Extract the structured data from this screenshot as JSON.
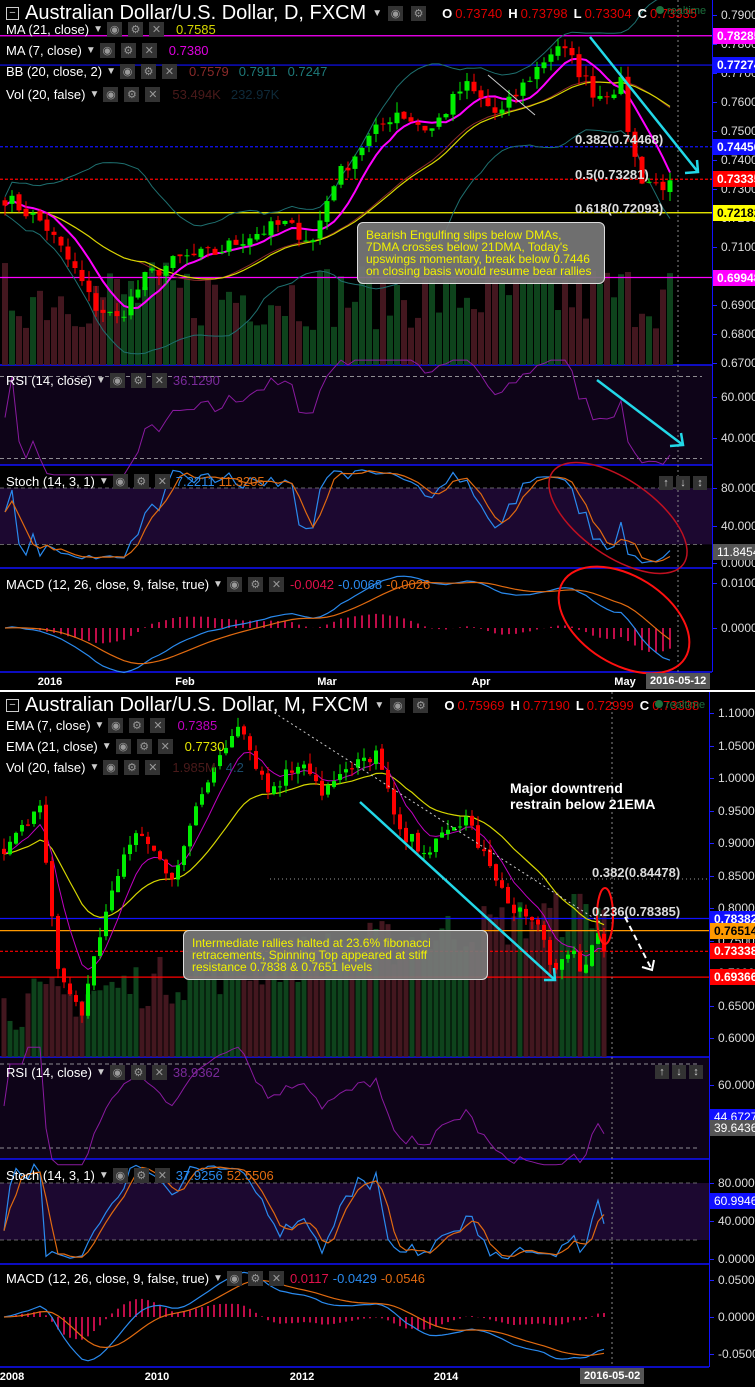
{
  "charts": [
    {
      "title": "Australian Dollar/U.S. Dollar, D, FXCM",
      "ohlc": {
        "O": "0.73740",
        "H": "0.73798",
        "L": "0.73304",
        "C": "0.73335"
      },
      "realtime_label": "realtime",
      "indicators": [
        {
          "label": "MA (21, close)",
          "values": [
            "0.7585"
          ],
          "colors": [
            "#d6d600"
          ]
        },
        {
          "label": "MA (7, close)",
          "values": [
            "0.7380"
          ],
          "colors": [
            "#e000e0"
          ]
        },
        {
          "label": "BB (20, close, 2)",
          "values": [
            "0.7579",
            "0.7911",
            "0.7247"
          ],
          "colors": [
            "#8a2a2a",
            "#1e7a7a",
            "#1e7a7a"
          ]
        },
        {
          "label": "Vol (20, false)",
          "values": [
            "53.494K",
            "232.97K"
          ],
          "colors": [
            "#4a1a1a",
            "#0e2a3a"
          ]
        }
      ],
      "price_ticks": [
        "0.79000",
        "0.78000",
        "0.77000",
        "0.76000",
        "0.75000",
        "0.74000",
        "0.73000",
        "0.72000",
        "0.71000",
        "0.70000",
        "0.69000",
        "0.68000",
        "0.67000"
      ],
      "level_tags": [
        {
          "value": "0.78285",
          "bg": "#ff00ff",
          "fg": "#ffffff"
        },
        {
          "value": "0.77274",
          "bg": "#1010ff",
          "fg": "#ffffff"
        },
        {
          "value": "0.74456",
          "bg": "#1010ff",
          "fg": "#ffffff"
        },
        {
          "value": "0.73335",
          "bg": "#ff0000",
          "fg": "#ffffff"
        },
        {
          "value": "0.72182",
          "bg": "#ffff00",
          "fg": "#000000"
        },
        {
          "value": "0.69948",
          "bg": "#ff00ff",
          "fg": "#ffffff"
        }
      ],
      "fib_labels": [
        "0.382(0.74468)",
        "0.5(0.73281)",
        "0.618(0.72093)"
      ],
      "callout": "Bearish Engulfing slips below DMAs, 7DMA crosses below 21DMA, Today's upswings momentary, break below 0.7446 on closing basis would resume bear rallies",
      "rsi": {
        "label": "RSI (14, close)",
        "value": "36.1290",
        "ticks": [
          "60.0000",
          "40.0000"
        ]
      },
      "stoch": {
        "label": "Stoch (14, 3, 1)",
        "values": [
          "7.2211",
          "11.3205"
        ],
        "ticks": [
          "80.0000",
          "40.0000",
          "0.0000"
        ],
        "tag": "11.8454"
      },
      "macd": {
        "label": "MACD (12, 26, close, 9, false, true)",
        "values": [
          "-0.0042",
          "-0.0068",
          "-0.0026"
        ],
        "ticks": [
          "0.0100",
          "0.0000"
        ]
      },
      "x_labels": [
        "2016",
        "Feb",
        "Mar",
        "Apr",
        "May"
      ],
      "cursor_date": "2016-05-12"
    },
    {
      "title": "Australian Dollar/U.S. Dollar, M, FXCM",
      "ohlc": {
        "O": "0.75969",
        "H": "0.77190",
        "L": "0.72999",
        "C": "0.73338"
      },
      "realtime_label": "realtime",
      "indicators": [
        {
          "label": "EMA (7, close)",
          "values": [
            "0.7385"
          ],
          "colors": [
            "#c000c0"
          ]
        },
        {
          "label": "EMA (21, close)",
          "values": [
            "0.7730"
          ],
          "colors": [
            "#e6e600"
          ]
        },
        {
          "label": "Vol (20, false)",
          "values": [
            "1.985M",
            "4.2"
          ],
          "colors": [
            "#4a1a1a",
            "#1a4a6a"
          ]
        }
      ],
      "price_ticks": [
        "1.10000",
        "1.05000",
        "1.00000",
        "0.95000",
        "0.90000",
        "0.85000",
        "0.80000",
        "0.75000",
        "0.70000",
        "0.65000",
        "0.60000"
      ],
      "level_tags": [
        {
          "value": "0.78382",
          "bg": "#1010ff",
          "fg": "#ffffff"
        },
        {
          "value": "0.76514",
          "bg": "#ff9900",
          "fg": "#000000"
        },
        {
          "value": "0.73338",
          "bg": "#ff0000",
          "fg": "#ffffff"
        },
        {
          "value": "0.69366",
          "bg": "#ff0000",
          "fg": "#ffffff"
        }
      ],
      "fib_labels": [
        "0.382(0.84478)",
        "0.236(0.78385)"
      ],
      "callout": "Intermediate rallies halted at 23.6% fibonacci retracements, Spinning Top appeared at stiff resistance 0.7838 & 0.7651 levels",
      "note": [
        "Major downtrend",
        "restrain below 21EMA"
      ],
      "rsi": {
        "label": "RSI (14, close)",
        "value": "38.9362",
        "ticks": [
          "60.0000"
        ],
        "tags": [
          "44.6727",
          "39.6436"
        ]
      },
      "stoch": {
        "label": "Stoch (14, 3, 1)",
        "values": [
          "37.9256",
          "52.5506"
        ],
        "ticks": [
          "80.0000",
          "40.0000",
          "0.0000"
        ],
        "tag": "60.9946"
      },
      "macd": {
        "label": "MACD (12, 26, close, 9, false, true)",
        "values": [
          "0.0117",
          "-0.0429",
          "-0.0546"
        ],
        "ticks": [
          "0.0500",
          "0.0000",
          "-0.0500"
        ]
      },
      "x_labels": [
        "2008",
        "2010",
        "2012",
        "2014",
        "2"
      ],
      "cursor_date": "2016-05-02"
    }
  ],
  "chart_data": [
    {
      "type": "candlestick",
      "title": "Australian Dollar/U.S. Dollar, D, FXCM",
      "ylim": [
        0.67,
        0.79
      ],
      "close_path": [
        [
          "2015-12-28",
          0.727
        ],
        [
          "2016-01-05",
          0.718
        ],
        [
          "2016-01-12",
          0.7
        ],
        [
          "2016-01-15",
          0.69
        ],
        [
          "2016-01-20",
          0.685
        ],
        [
          "2016-01-26",
          0.7
        ],
        [
          "2016-02-02",
          0.706
        ],
        [
          "2016-02-09",
          0.708
        ],
        [
          "2016-02-16",
          0.714
        ],
        [
          "2016-02-23",
          0.718
        ],
        [
          "2016-02-29",
          0.712
        ],
        [
          "2016-03-04",
          0.732
        ],
        [
          "2016-03-10",
          0.745
        ],
        [
          "2016-03-17",
          0.757
        ],
        [
          "2016-03-24",
          0.75
        ],
        [
          "2016-03-31",
          0.766
        ],
        [
          "2016-04-07",
          0.755
        ],
        [
          "2016-04-14",
          0.77
        ],
        [
          "2016-04-19",
          0.78
        ],
        [
          "2016-04-22",
          0.774
        ],
        [
          "2016-04-27",
          0.762
        ],
        [
          "2016-05-02",
          0.766
        ],
        [
          "2016-05-04",
          0.745
        ],
        [
          "2016-05-06",
          0.734
        ],
        [
          "2016-05-10",
          0.731
        ],
        [
          "2016-05-12",
          0.733
        ]
      ],
      "levels": [
        0.78285,
        0.77274,
        0.74456,
        0.73335,
        0.72182,
        0.69948
      ],
      "colors": {
        "up": "#00ee00",
        "down": "#ff0000"
      }
    },
    {
      "type": "candlestick",
      "title": "Australian Dollar/U.S. Dollar, M, FXCM",
      "ylim": [
        0.6,
        1.1
      ],
      "close_path": [
        [
          "2008-01-01",
          0.88
        ],
        [
          "2008-07-01",
          0.96
        ],
        [
          "2008-10-01",
          0.7
        ],
        [
          "2009-02-01",
          0.64
        ],
        [
          "2009-06-01",
          0.8
        ],
        [
          "2009-11-01",
          0.92
        ],
        [
          "2010-05-01",
          0.85
        ],
        [
          "2010-12-01",
          1.02
        ],
        [
          "2011-04-01",
          1.09
        ],
        [
          "2011-09-01",
          0.98
        ],
        [
          "2012-03-01",
          1.03
        ],
        [
          "2012-06-01",
          0.98
        ],
        [
          "2013-03-01",
          1.04
        ],
        [
          "2013-07-01",
          0.91
        ],
        [
          "2013-12-01",
          0.89
        ],
        [
          "2014-06-01",
          0.94
        ],
        [
          "2014-12-01",
          0.82
        ],
        [
          "2015-06-01",
          0.77
        ],
        [
          "2015-09-01",
          0.7
        ],
        [
          "2015-12-01",
          0.73
        ],
        [
          "2016-01-01",
          0.7
        ],
        [
          "2016-04-01",
          0.76
        ],
        [
          "2016-05-01",
          0.733
        ]
      ],
      "levels": [
        0.78382,
        0.76514,
        0.73338,
        0.69366
      ],
      "colors": {
        "up": "#00ee00",
        "down": "#ff0000"
      }
    }
  ]
}
